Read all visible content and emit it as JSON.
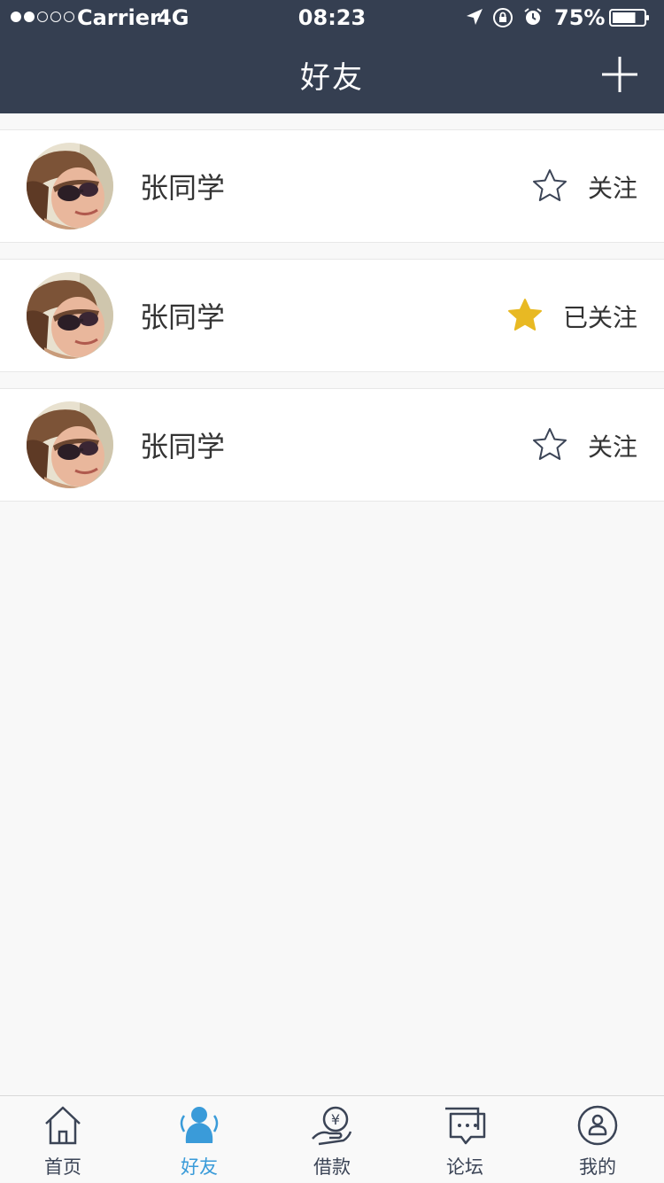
{
  "status_bar": {
    "carrier": "Carrier",
    "network": "4G",
    "time": "08:23",
    "battery": "75%",
    "battery_level": 0.75
  },
  "nav": {
    "title": "好友"
  },
  "friends": [
    {
      "name": "张同学",
      "follow_label": "关注",
      "followed": false,
      "star_icon": "star-outline-icon"
    },
    {
      "name": "张同学",
      "follow_label": "已关注",
      "followed": true,
      "star_icon": "star-filled-icon"
    },
    {
      "name": "张同学",
      "follow_label": "关注",
      "followed": false,
      "star_icon": "star-outline-icon"
    }
  ],
  "tabbar": {
    "items": [
      {
        "label": "首页",
        "icon": "home-icon",
        "active": false
      },
      {
        "label": "好友",
        "icon": "friends-icon",
        "active": true
      },
      {
        "label": "借款",
        "icon": "loan-icon",
        "active": false
      },
      {
        "label": "论坛",
        "icon": "forum-icon",
        "active": false
      },
      {
        "label": "我的",
        "icon": "profile-icon",
        "active": false
      }
    ]
  },
  "colors": {
    "header_bg": "#353f51",
    "star_filled": "#e8b923",
    "active_tab": "#3a9bd9",
    "inactive_tab": "#3b4456"
  }
}
